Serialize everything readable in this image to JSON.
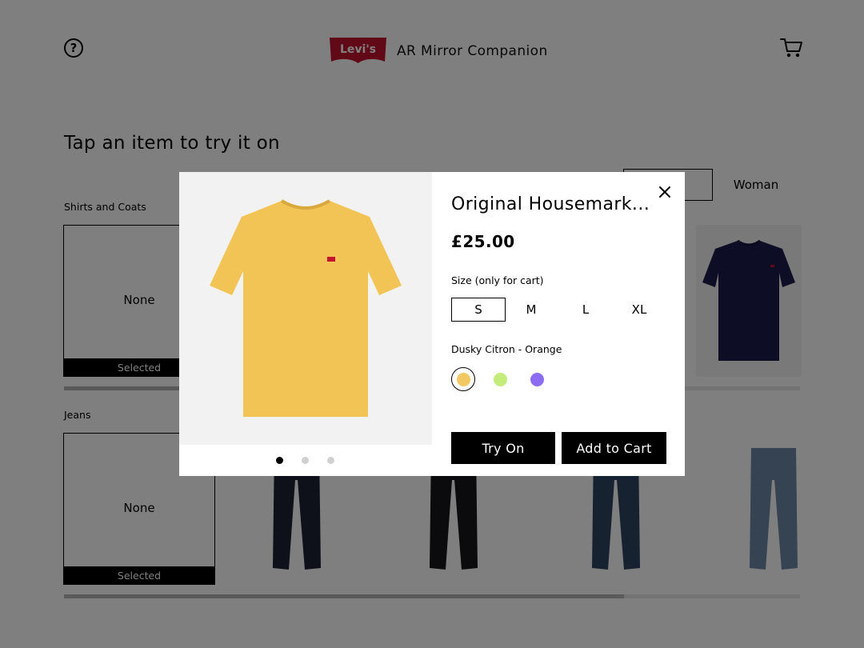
{
  "header": {
    "help_icon": "question-circle-icon",
    "logo_text": "Levi's",
    "title": "AR Mirror Companion",
    "cart_icon": "shopping-cart-icon"
  },
  "main": {
    "heading": "Tap an item to try it on",
    "tabs": [
      {
        "label": "",
        "selected": true
      },
      {
        "label": "Woman",
        "selected": false
      }
    ],
    "sections": [
      {
        "label": "Shirts and Coats",
        "none_label": "None",
        "selected_label": "Selected",
        "scroll_position": 0.16
      },
      {
        "label": "Jeans",
        "none_label": "None",
        "selected_label": "Selected",
        "scroll_position": 0.76
      }
    ]
  },
  "modal": {
    "product_name": "Original Housemark...",
    "price": "£25.00",
    "size_label": "Size (only for cart)",
    "sizes": [
      "S",
      "M",
      "L",
      "XL"
    ],
    "selected_size": "S",
    "color_label": "Dusky Citron - Orange",
    "swatches": [
      "#f2c862",
      "#c3ec7a",
      "#8c6cf0"
    ],
    "selected_swatch": 0,
    "image_dots": 3,
    "active_dot": 0,
    "try_on_label": "Try On",
    "add_to_cart_label": "Add to Cart",
    "close_icon": "close-icon"
  },
  "colors": {
    "overlay": "rgba(0,0,0,0.5)",
    "brand_red": "#c41230",
    "tshirt_yellow": "#f2c456",
    "tshirt_navy": "#1b1d4a"
  }
}
